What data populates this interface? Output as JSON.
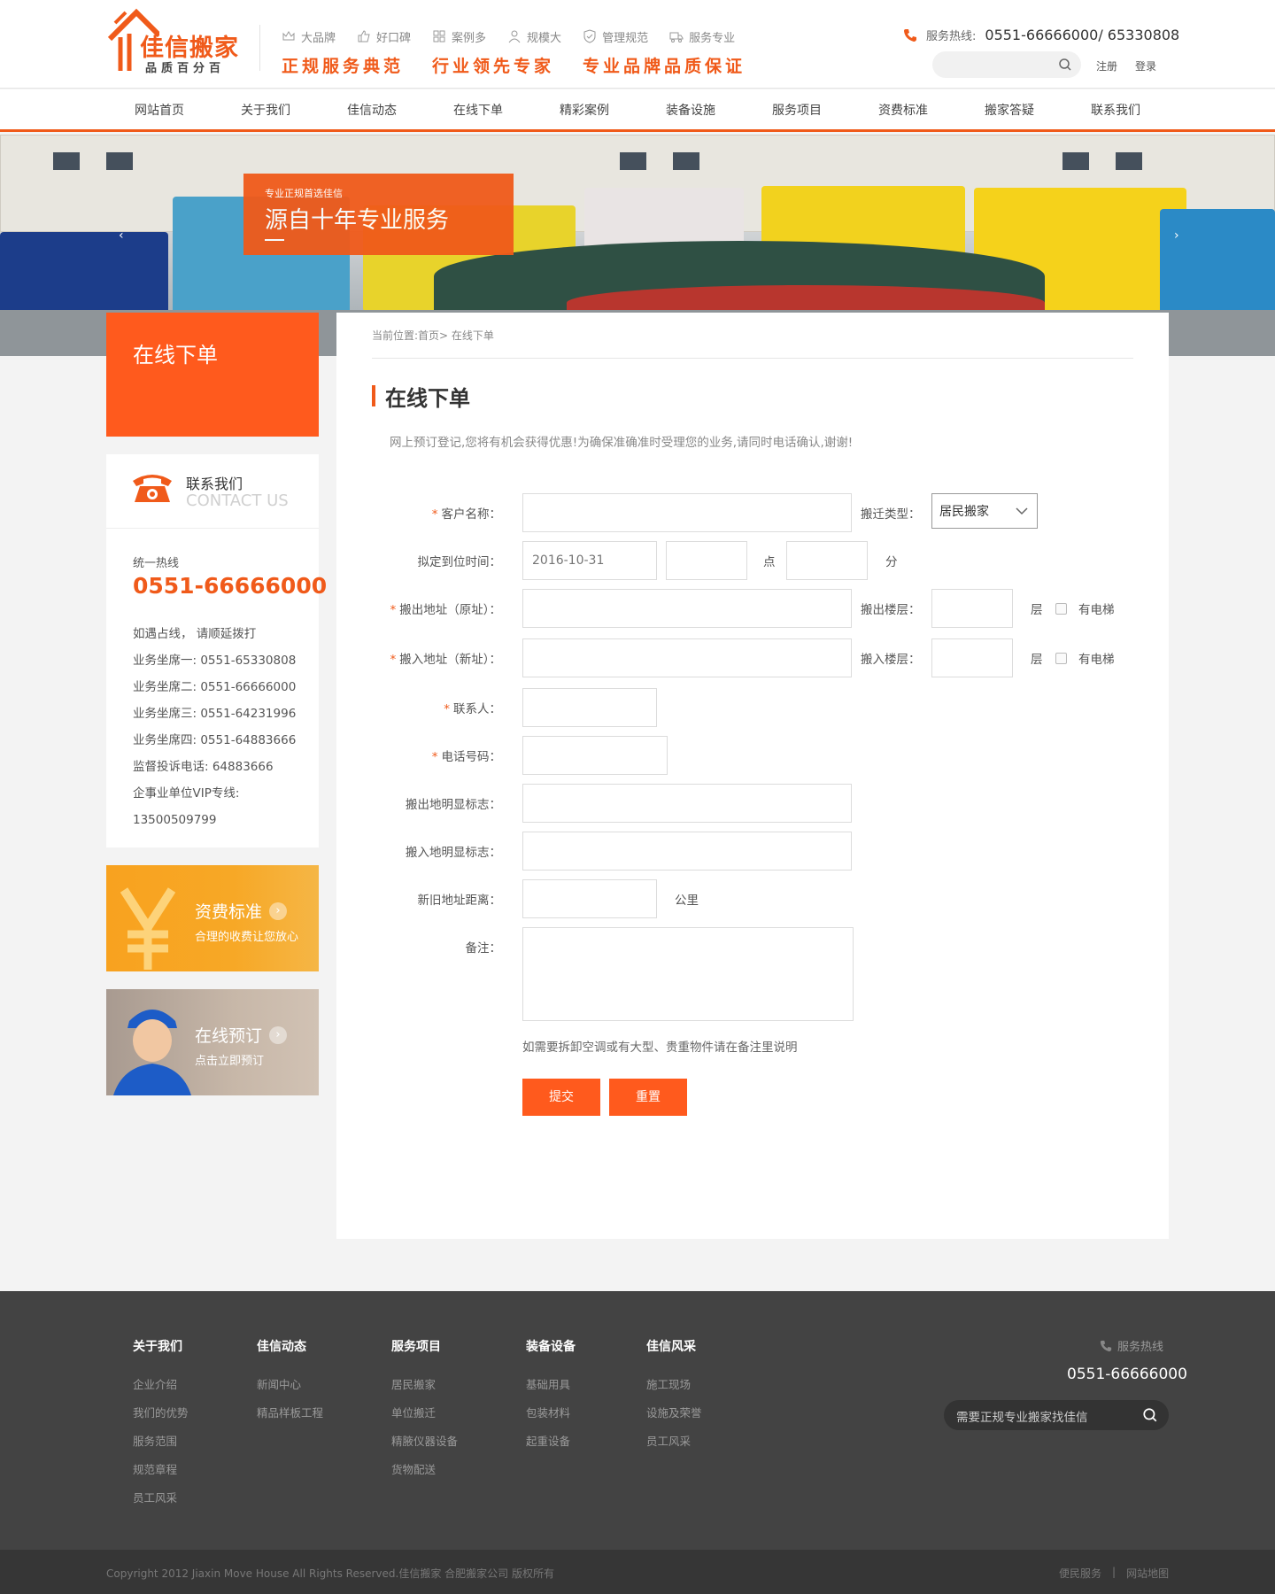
{
  "logo": {
    "name": "佳信搬家",
    "tagline": "品质百分百"
  },
  "features": [
    "大品牌",
    "好口碑",
    "案例多",
    "规模大",
    "管理规范",
    "服务专业"
  ],
  "slogans": [
    "正规服务典范",
    "行业领先专家",
    "专业品牌品质保证"
  ],
  "hotline": {
    "label": "服务热线:",
    "number": "0551-66666000/ 65330808"
  },
  "auth": {
    "register": "注册",
    "login": "登录"
  },
  "nav": [
    "网站首页",
    "关于我们",
    "佳信动态",
    "在线下单",
    "精彩案例",
    "装备设施",
    "服务项目",
    "资费标准",
    "搬家答疑",
    "联系我们"
  ],
  "banner": {
    "small": "专业正规首选佳信",
    "big": "源自十年专业服务",
    "prev": "‹",
    "next": "›"
  },
  "sidebar": {
    "title": "在线下单",
    "contact_title": "联系我们",
    "contact_en": "CONTACT US",
    "hotline_label": "统一热线",
    "hotline_number": "0551-66666000",
    "lines": [
      "如遇占线， 请顺延拨打",
      "业务坐席一: 0551-65330808",
      "业务坐席二: 0551-66666000",
      "业务坐席三: 0551-64231996",
      "业务坐席四: 0551-64883666",
      "监督投诉电话: 64883666",
      "企事业单位VIP专线:",
      "13500509799"
    ],
    "promo1_title": "资费标准",
    "promo1_sub": "合理的收费让您放心",
    "promo2_title": "在线预订",
    "promo2_sub": "点击立即预订"
  },
  "main": {
    "breadcrumb": "当前位置:首页>  在线下单",
    "title": "在线下单",
    "intro": "网上预订登记,您将有机会获得优惠!为确保准确准时受理您的业务,请同时电话确认,谢谢!",
    "labels": {
      "customer": "客户名称：",
      "move_type": "搬迁类型：",
      "arrival": "拟定到位时间：",
      "hour": "点",
      "minute": "分",
      "from_addr": "搬出地址（原址）：",
      "from_floor": "搬出楼层：",
      "to_addr": "搬入地址（新址）：",
      "to_floor": "搬入楼层：",
      "floor_unit": "层",
      "elevator": "有电梯",
      "contact": "联系人：",
      "phone": "电话号码：",
      "from_mark": "搬出地明显标志：",
      "to_mark": "搬入地明显标志：",
      "distance": "新旧地址距离：",
      "distance_unit": "公里",
      "remark": "备注："
    },
    "required": "*",
    "move_type_value": "居民搬家",
    "date_placeholder": "2016-10-31",
    "note": "如需要拆卸空调或有大型、贵重物件请在备注里说明",
    "submit": "提交",
    "reset": "重置"
  },
  "footer": {
    "cols": [
      {
        "title": "关于我们",
        "items": [
          "企业介绍",
          "我们的优势",
          "服务范围",
          "规范章程",
          "员工风采"
        ]
      },
      {
        "title": "佳信动态",
        "items": [
          "新闻中心",
          "精品样板工程"
        ]
      },
      {
        "title": "服务项目",
        "items": [
          "居民搬家",
          "单位搬迁",
          "精腋仪器设备",
          "货物配送"
        ]
      },
      {
        "title": "装备设备",
        "items": [
          "基础用具",
          "包装材料",
          "起重设备"
        ]
      },
      {
        "title": "佳信风采",
        "items": [
          "施工现场",
          "设施及荣誉",
          "员工风采"
        ]
      }
    ],
    "hot_label": "服务热线",
    "hot_number": "0551-66666000",
    "search_text": "需要正规专业搬家找佳信",
    "copyright": "Copyright 2012 Jiaxin Move House All Rights Reserved.佳信搬家 合肥搬家公司 版权所有",
    "links": [
      "便民服务",
      "|",
      "网站地图"
    ]
  },
  "colors": {
    "accent": "#f05a1a",
    "footer": "#434343"
  }
}
